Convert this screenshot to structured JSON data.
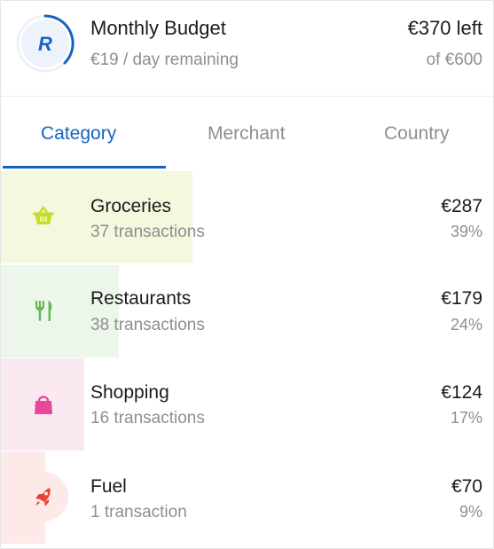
{
  "header": {
    "title": "Monthly Budget",
    "subtitle": "€19 / day remaining",
    "amount_left": "€370 left",
    "amount_total": "of €600",
    "logo_letter": "R",
    "brand_color": "#1565c0"
  },
  "tabs": [
    {
      "label": "Category",
      "active": true
    },
    {
      "label": "Merchant",
      "active": false
    },
    {
      "label": "Country",
      "active": false
    }
  ],
  "categories": [
    {
      "name": "Groceries",
      "count": "37 transactions",
      "amount": "€287",
      "percent": "39%",
      "share": 0.39,
      "icon": "basket-icon",
      "color": "#c5dd28",
      "bg": "#f4f8df"
    },
    {
      "name": "Restaurants",
      "count": "38 transactions",
      "amount": "€179",
      "percent": "24%",
      "share": 0.24,
      "icon": "fork-knife-icon",
      "color": "#5dbb4e",
      "bg": "#ecf6ea"
    },
    {
      "name": "Shopping",
      "count": "16 transactions",
      "amount": "€124",
      "percent": "17%",
      "share": 0.17,
      "icon": "shopping-bag-icon",
      "color": "#e8489a",
      "bg": "#fbe9f1"
    },
    {
      "name": "Fuel",
      "count": "1 transaction",
      "amount": "€70",
      "percent": "9%",
      "share": 0.09,
      "icon": "rocket-icon",
      "color": "#ea4335",
      "bg": "#fce9e8"
    }
  ]
}
